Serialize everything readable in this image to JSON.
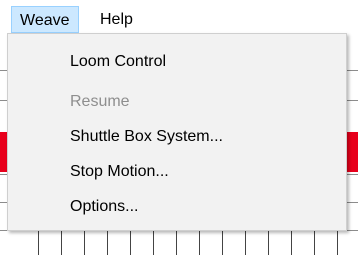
{
  "menubar": {
    "items": [
      {
        "label": "Weave",
        "state": "open"
      },
      {
        "label": "Help"
      }
    ]
  },
  "weave_menu": {
    "items": [
      {
        "label": "Loom Control",
        "enabled": true
      },
      {
        "label": "Resume",
        "enabled": false
      },
      {
        "label": "Shuttle Box System...",
        "enabled": true
      },
      {
        "label": "Stop Motion...",
        "enabled": true
      },
      {
        "label": "Options...",
        "enabled": true
      }
    ]
  },
  "colors": {
    "menu_highlight": "#cce8ff",
    "menu_background": "#f2f2f2",
    "disabled_text": "#8e8e8e",
    "red_band": "#e8001c"
  }
}
